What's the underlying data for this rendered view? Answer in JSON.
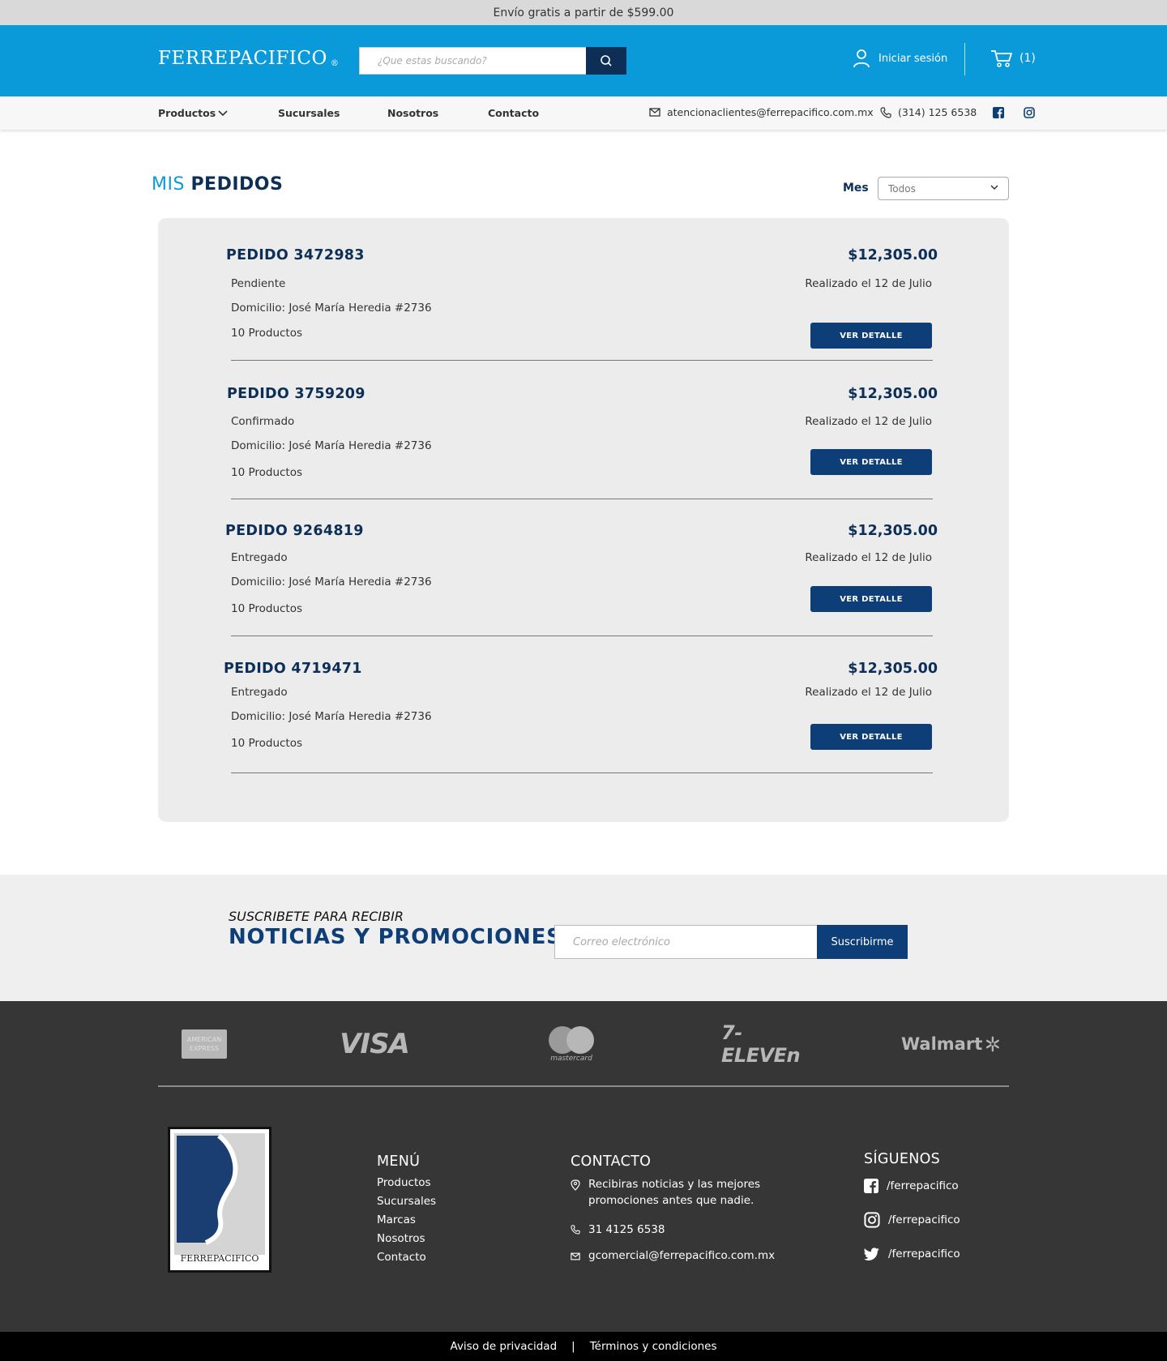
{
  "topbar": {
    "text": "Envío gratis a partir de $599.00"
  },
  "header": {
    "logo": "FERREPACIFICO",
    "logo_mark": "®",
    "search_placeholder": "¿Que estas buscando?",
    "login_label": "Iniciar sesión",
    "cart_count": "(1)"
  },
  "nav": {
    "items": [
      "Productos",
      "Sucursales",
      "Nosotros",
      "Contacto"
    ],
    "email": "atencionaclientes@ferrepacifico.com.mx",
    "phone": "(314) 125 6538"
  },
  "page": {
    "title_light": "MIS",
    "title_bold": "PEDIDOS",
    "filter_label": "Mes",
    "filter_value": "Todos"
  },
  "orders": [
    {
      "id": "PEDIDO 3472983",
      "total": "$12,305.00",
      "status": "Pendiente",
      "date": "Realizado el 12 de Julio",
      "address": "Domicilio: José María Heredia #2736",
      "items": "10 Productos",
      "button": "VER DETALLE"
    },
    {
      "id": "PEDIDO 3759209",
      "total": "$12,305.00",
      "status": "Confirmado",
      "date": "Realizado el 12 de Julio",
      "address": "Domicilio: José María Heredia #2736",
      "items": "10 Productos",
      "button": "VER DETALLE"
    },
    {
      "id": "PEDIDO 9264819",
      "total": "$12,305.00",
      "status": "Entregado",
      "date": "Realizado el 12 de Julio",
      "address": "Domicilio: José María Heredia #2736",
      "items": "10 Productos",
      "button": "VER DETALLE"
    },
    {
      "id": "PEDIDO 4719471",
      "total": "$12,305.00",
      "status": "Entregado",
      "date": "Realizado el 12 de Julio",
      "address": "Domicilio: José María Heredia #2736",
      "items": "10 Productos",
      "button": "VER DETALLE"
    }
  ],
  "newsletter": {
    "small": "SUSCRIBETE PARA RECIBIR",
    "big": "NOTICIAS Y PROMOCIONES",
    "placeholder": "Correo electrónico",
    "button": "Suscribirme"
  },
  "payments": {
    "amex_line1": "AMERICAN",
    "amex_line2": "EXPRESS",
    "visa": "VISA",
    "mastercard": "mastercard",
    "seven_eleven": "7-ELEVEn",
    "walmart": "Walmart"
  },
  "footer": {
    "brand_label": "FERREPACIFICO",
    "menu_title": "MENÚ",
    "menu_items": [
      "Productos",
      "Sucursales",
      "Marcas",
      "Nosotros",
      "Contacto"
    ],
    "contact_title": "CONTACTO",
    "contact_text": "Recibiras noticias y las mejores promociones antes que nadie.",
    "contact_phone": "31 4125 6538",
    "contact_email": "gcomercial@ferrepacifico.com.mx",
    "follow_title": "SÍGUENOS",
    "social": [
      "/ferrepacifico",
      "/ferrepacifico",
      "/ferrepacifico"
    ]
  },
  "legal": {
    "privacy": "Aviso de privacidad",
    "separator": "|",
    "terms": "Términos y condiciones"
  },
  "colors": {
    "brand_blue": "#0b9ad9",
    "navy": "#0d2f57",
    "button_navy": "#0d3e78",
    "footer_dark": "#363636"
  }
}
